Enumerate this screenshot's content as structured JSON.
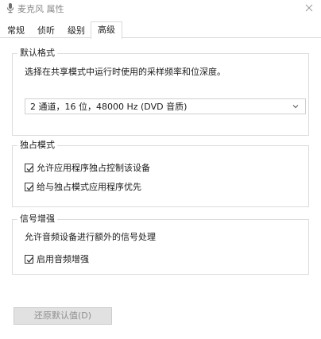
{
  "window": {
    "title": "麦克风 属性",
    "icon": "microphone-icon",
    "close_icon": "close-icon"
  },
  "tabs": [
    {
      "label": "常规",
      "active": false
    },
    {
      "label": "侦听",
      "active": false
    },
    {
      "label": "级别",
      "active": false
    },
    {
      "label": "高级",
      "active": true
    }
  ],
  "default_format": {
    "title": "默认格式",
    "description": "选择在共享模式中运行时使用的采样频率和位深度。",
    "selected_value": "2 通道，16 位，48000 Hz (DVD 音质)"
  },
  "exclusive_mode": {
    "title": "独占模式",
    "options": [
      {
        "label": "允许应用程序独占控制该设备",
        "checked": true
      },
      {
        "label": "给与独占模式应用程序优先",
        "checked": true
      }
    ]
  },
  "signal_enhancement": {
    "title": "信号增强",
    "description": "允许音频设备进行额外的信号处理",
    "options": [
      {
        "label": "启用音频增强",
        "checked": true
      }
    ]
  },
  "buttons": {
    "restore_defaults": "还原默认值(D)"
  }
}
